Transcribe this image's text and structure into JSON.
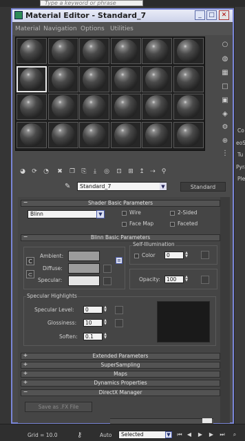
{
  "background": {
    "search_placeholder": "Type a keyword or phrase",
    "right_labels": [
      "Co",
      "eoSp",
      "Tu",
      "Pyra",
      "Ple"
    ]
  },
  "window": {
    "title": "Material Editor - Standard_7",
    "controls": {
      "minimize": "_",
      "maximize": "□",
      "close": "✕"
    }
  },
  "menu": [
    "Material",
    "Navigation",
    "Options",
    "Utilities"
  ],
  "slot_grid": {
    "rows": 4,
    "cols": 6,
    "selected_row": 1,
    "selected_col": 0
  },
  "material": {
    "name": "Standard_7",
    "type": "Standard"
  },
  "shader_basic": {
    "title": "Shader Basic Parameters",
    "shader": "Blinn",
    "options": [
      "Wire",
      "2-Sided",
      "Face Map",
      "Faceted"
    ]
  },
  "blinn_basic": {
    "title": "Blinn Basic Parameters",
    "ambient_label": "Ambient:",
    "diffuse_label": "Diffuse:",
    "specular_label": "Specular:",
    "ambient_color": "#9c9c9c",
    "diffuse_color": "#9c9c9c",
    "specular_color": "#e6e6e6",
    "lock_letter": "C",
    "self_illum_title": "Self-Illumination",
    "color_label": "Color",
    "color_value": "0",
    "opacity_label": "Opacity:",
    "opacity_value": "100"
  },
  "specular_highlights": {
    "title": "Specular Highlights",
    "level_label": "Specular Level:",
    "level_value": "0",
    "gloss_label": "Glossiness:",
    "gloss_value": "10",
    "soften_label": "Soften:",
    "soften_value": "0.1"
  },
  "rollouts": [
    "Extended Parameters",
    "SuperSampling",
    "Maps",
    "Dynamics Properties",
    "DirectX Manager"
  ],
  "fx_button": "Save as .FX File",
  "statusbar": {
    "grid": "Grid = 10.0",
    "auto": "Auto",
    "selected": "Selected"
  },
  "colors": {
    "window_border": "#7a86d8",
    "panel": "#454545",
    "slot_bg": "#1e1e1e"
  }
}
